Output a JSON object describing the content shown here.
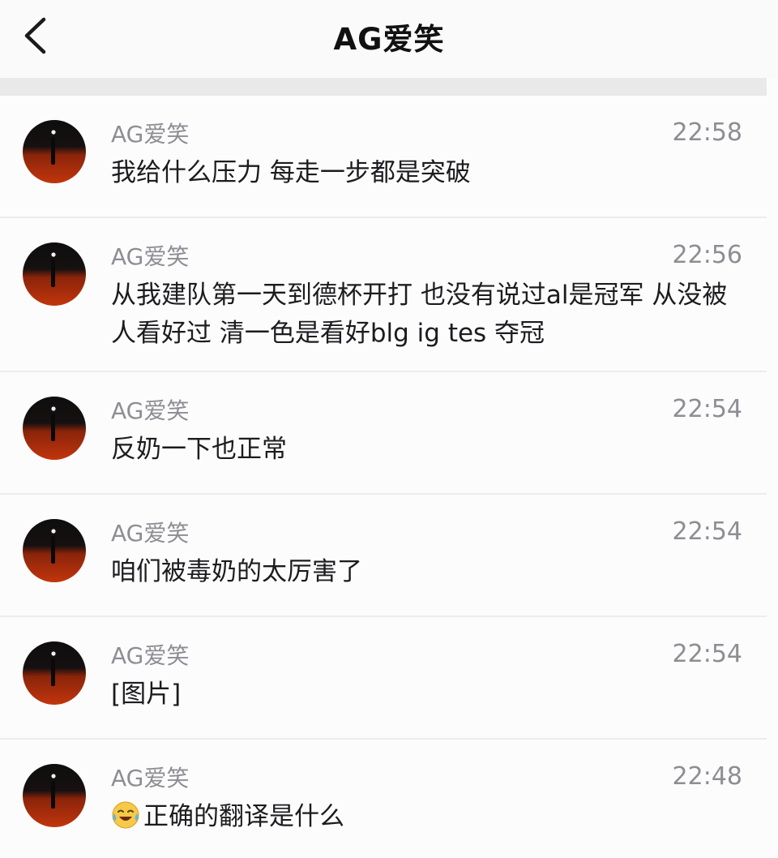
{
  "header": {
    "title": "AG爱笑",
    "back_icon": "chevron-left-icon"
  },
  "colors": {
    "avatar_top": "#0e0e0e",
    "avatar_bottom": "#c2350d",
    "secondary_text": "#8d8d93",
    "primary_text": "#1c1c1e"
  },
  "messages": [
    {
      "name": "AG爱笑",
      "time": "22:58",
      "text": "我给什么压力 每走一步都是突破"
    },
    {
      "name": "AG爱笑",
      "time": "22:56",
      "text": "从我建队第一天到德杯开打 也没有说过al是冠军 从没被人看好过 清一色是看好blg ig tes 夺冠"
    },
    {
      "name": "AG爱笑",
      "time": "22:54",
      "text": "反奶一下也正常"
    },
    {
      "name": "AG爱笑",
      "time": "22:54",
      "text": "咱们被毒奶的太厉害了"
    },
    {
      "name": "AG爱笑",
      "time": "22:54",
      "text": "[图片]"
    },
    {
      "name": "AG爱笑",
      "time": "22:48",
      "text": "正确的翻译是什么",
      "emoji": "laughing-crying-emoji"
    }
  ]
}
